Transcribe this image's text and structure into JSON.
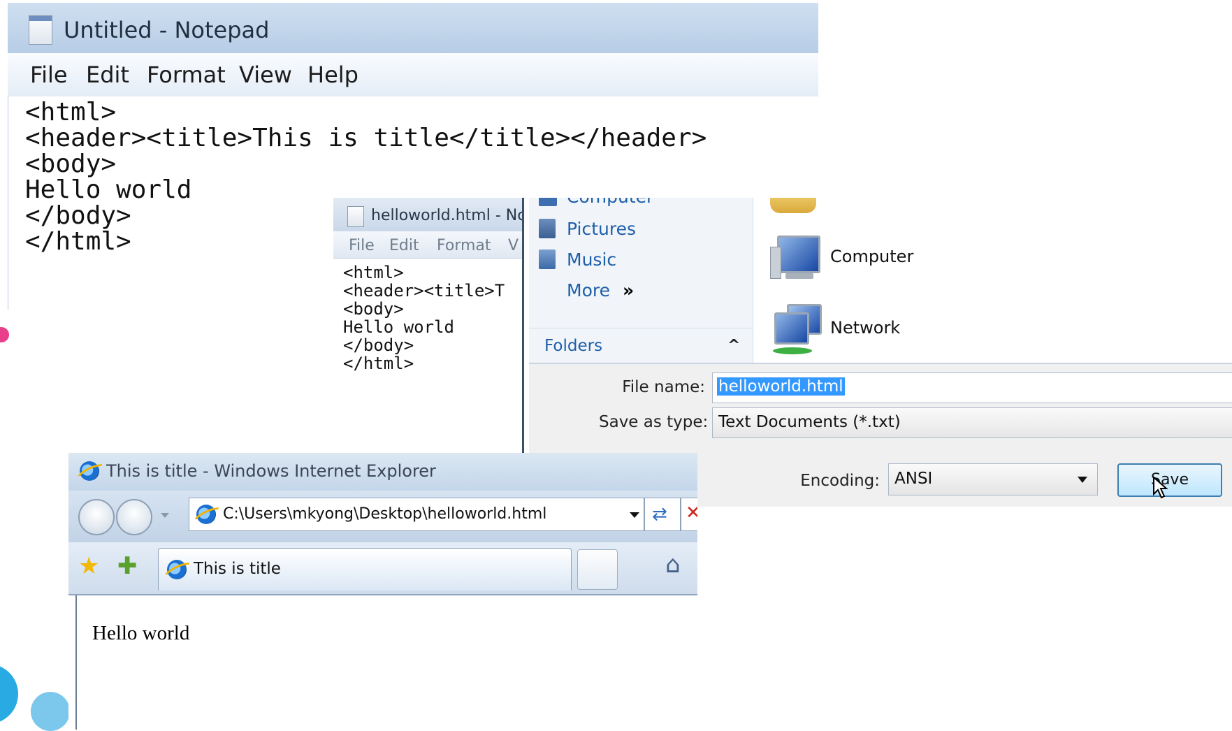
{
  "notepad_main": {
    "title": "Untitled - Notepad",
    "menu": [
      "File",
      "Edit",
      "Format",
      "View",
      "Help"
    ],
    "content": "<html>\n<header><title>This is title</title></header>\n<body>\nHello world\n</body>\n</html>"
  },
  "notepad_saved": {
    "title": "helloworld.html - Nc",
    "menu": [
      "File",
      "Edit",
      "Format",
      "V"
    ],
    "content": "<html>\n<header><title>T\n<body>\nHello world\n</body>\n</html>"
  },
  "save_dialog": {
    "nav_items": [
      "Computer",
      "Pictures",
      "Music"
    ],
    "more_label": "More",
    "more_chevron": "»",
    "folders_label": "Folders",
    "folders_chevron": "^",
    "items": [
      {
        "label": "Computer",
        "icon": "computer-icon"
      },
      {
        "label": "Network",
        "icon": "network-icon"
      }
    ],
    "file_name_label": "File name:",
    "file_name_value": "helloworld.html",
    "save_as_type_label": "Save as type:",
    "save_as_type_value": "Text Documents (*.txt)",
    "encoding_label": "Encoding:",
    "encoding_value": "ANSI",
    "save_button": "Save"
  },
  "ie": {
    "title": "This is title - Windows Internet Explorer",
    "address": "C:\\Users\\mkyong\\Desktop\\helloworld.html",
    "tab_title": "This is title",
    "page_text": "Hello world"
  },
  "colors": {
    "accent_blue": "#1e5fa8",
    "selection": "#3399ff",
    "decor_pink": "#e83e8c",
    "decor_cyan": "#29aae2"
  }
}
